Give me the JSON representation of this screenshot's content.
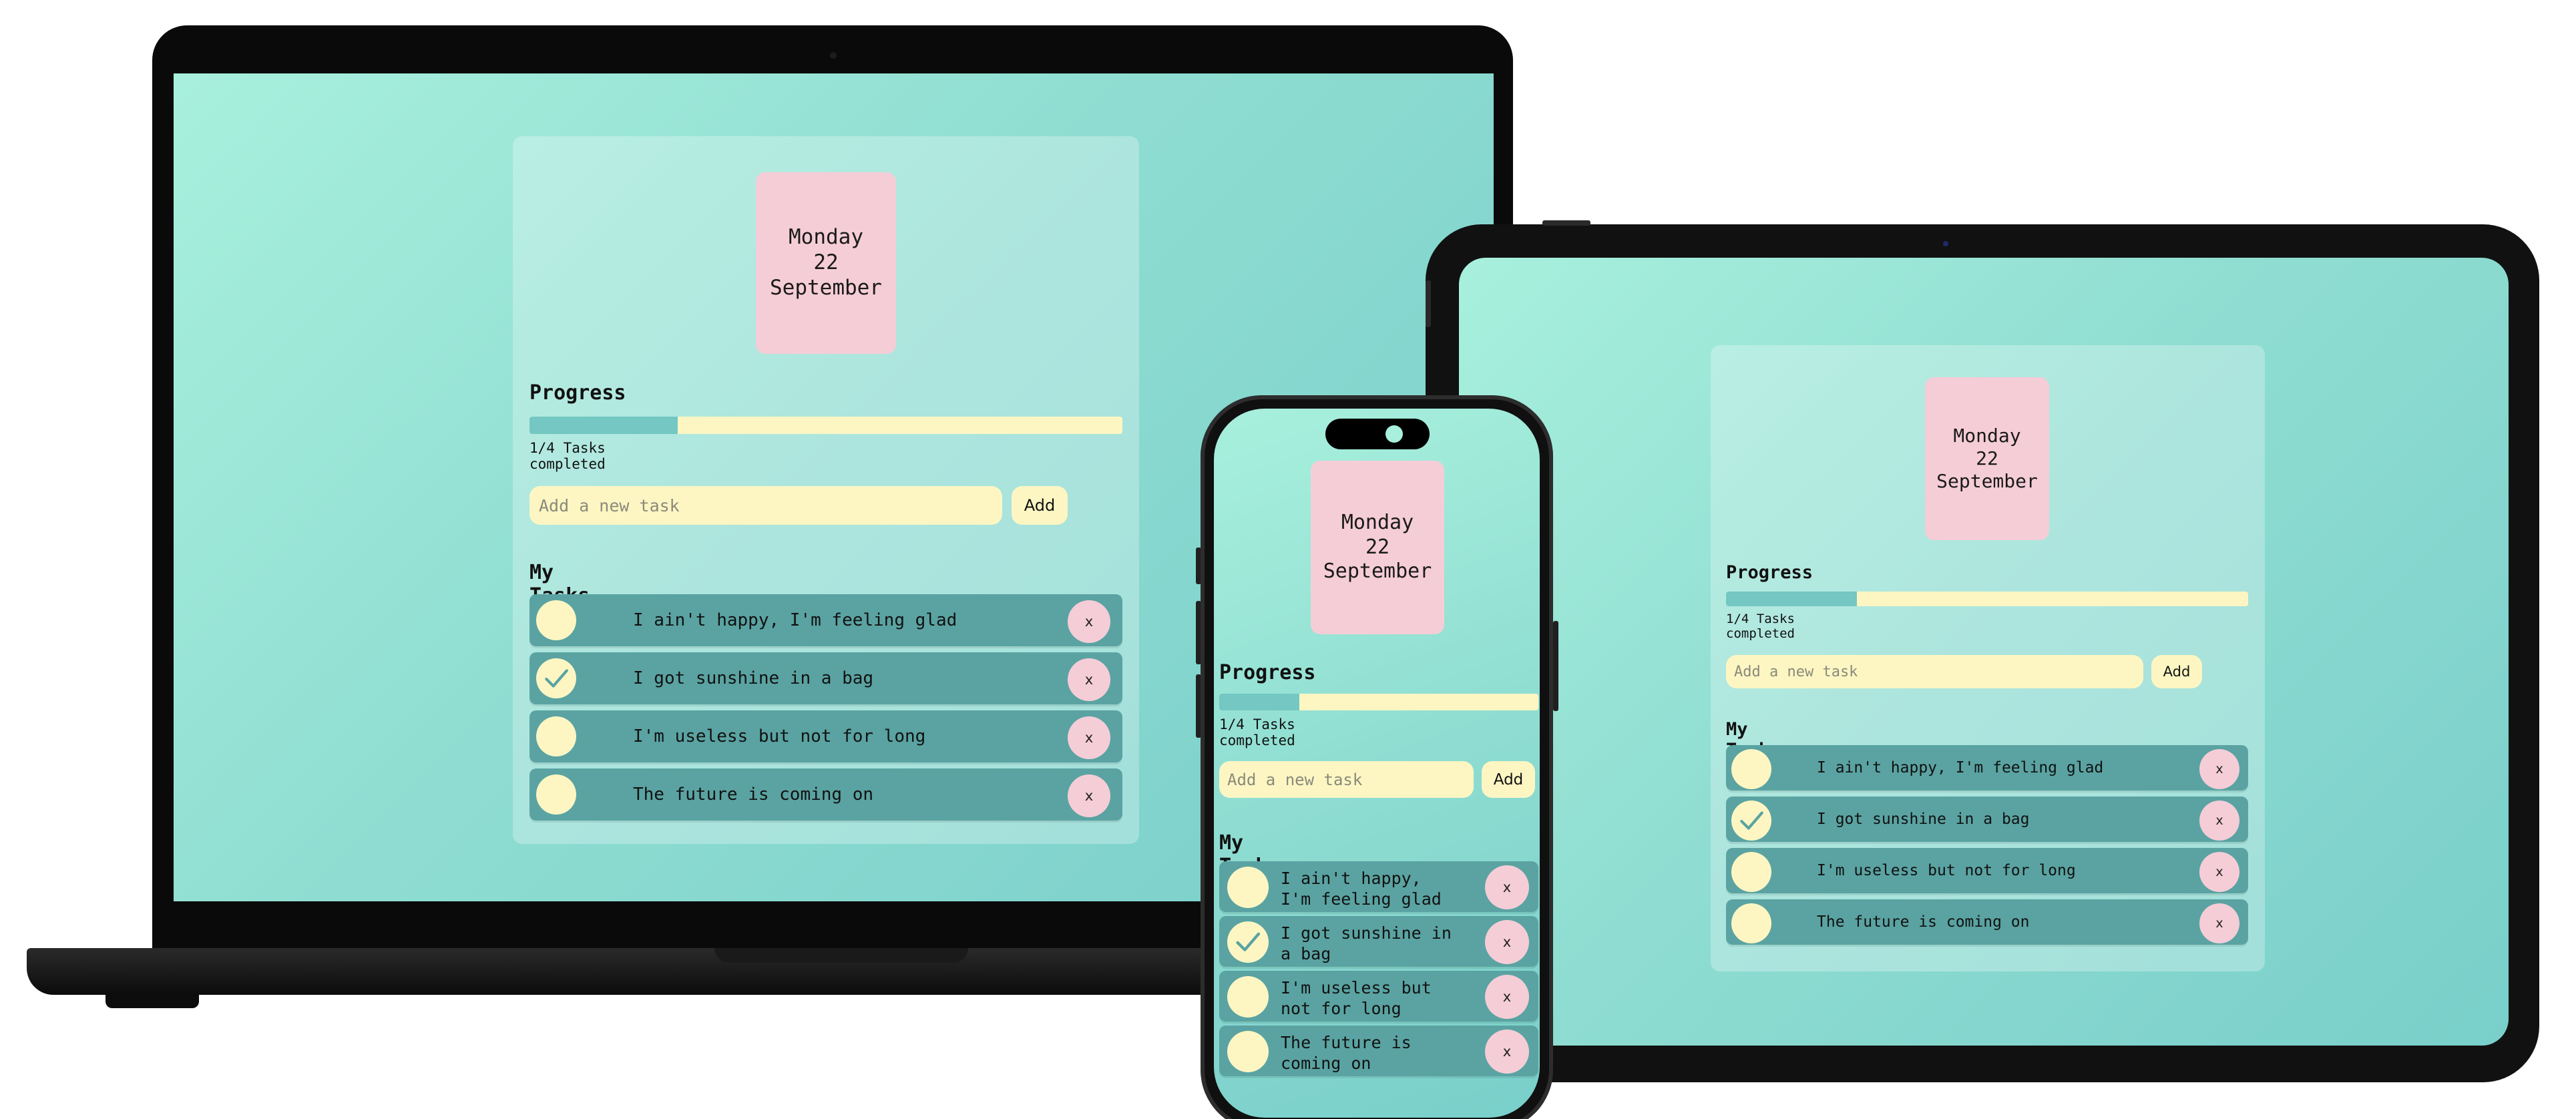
{
  "app": {
    "date": {
      "weekday": "Monday",
      "day": "22",
      "month": "September"
    },
    "progress_title": "Progress",
    "progress_fraction": 0.25,
    "progress_caption": "1/4 Tasks completed",
    "new_task_placeholder": "Add a new task",
    "add_label": "Add",
    "tasks_title": "My Tasks",
    "delete_label": "x",
    "tasks": [
      {
        "text": "I ain't happy, I'm feeling glad",
        "done": false
      },
      {
        "text": "I got sunshine in a bag",
        "done": true
      },
      {
        "text": "I'm useless but not for long",
        "done": false
      },
      {
        "text": "The future is coming on",
        "done": false
      }
    ]
  },
  "colors": {
    "screen_bg_start": "#a8f0dd",
    "screen_bg_end": "#79cfca",
    "card_bg": "#b3e8e0",
    "date_tile": "#f5cdd7",
    "cream": "#fdf6c3",
    "task_row": "#5aa3a2",
    "progress_fill": "#74c7c2",
    "delete_button": "#f5cdd7",
    "checkmark": "#5aa3a2"
  },
  "icons": {
    "completed_check": "checkmark-icon"
  }
}
